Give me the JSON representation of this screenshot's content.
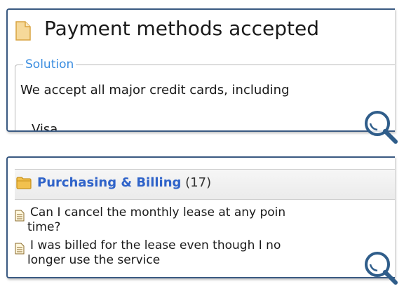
{
  "article": {
    "title": "Payment methods accepted",
    "section_label": "Solution",
    "answer_text": "We accept all major credit cards, including",
    "list_first": "Visa"
  },
  "category": {
    "name": "Purchasing & Billing",
    "count": "(17)",
    "items": [
      {
        "line1": "Can I cancel the monthly lease at any poin",
        "line2": "time?"
      },
      {
        "line1": "I was billed for the lease even though I no",
        "line2": "longer use the service"
      }
    ]
  },
  "icons": {
    "doc": "document-icon",
    "folder": "folder-icon",
    "search": "magnifier-icon"
  },
  "colors": {
    "frame": "#3a5a82",
    "accent": "#3a8de0",
    "link": "#2f63c9",
    "folder": "#f2c14e"
  }
}
